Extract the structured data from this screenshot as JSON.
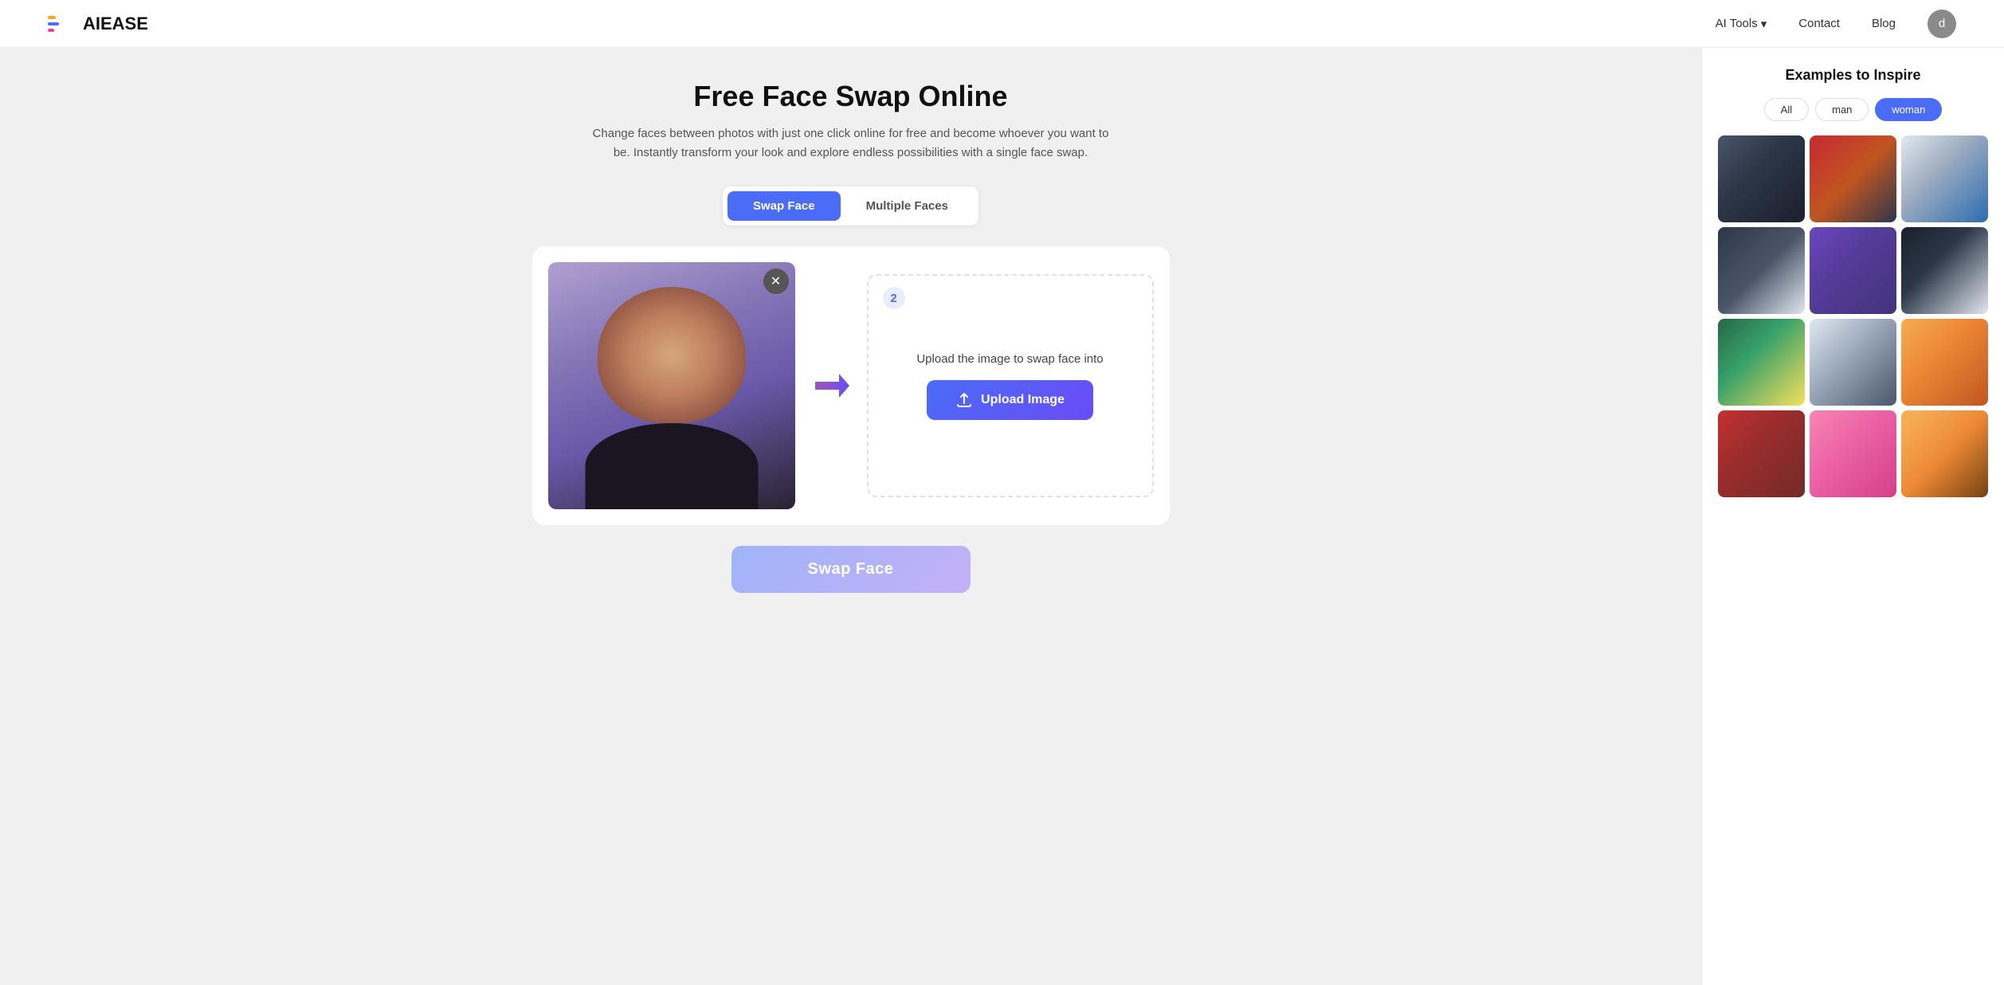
{
  "nav": {
    "logo_text": "AIEASE",
    "links": [
      {
        "label": "AI Tools",
        "has_dropdown": true
      },
      {
        "label": "Contact",
        "has_dropdown": false
      },
      {
        "label": "Blog",
        "has_dropdown": false
      }
    ],
    "avatar_letter": "d"
  },
  "main": {
    "page_title": "Free Face Swap Online",
    "page_description": "Change faces between photos with just one click online for free and become whoever you want to be. Instantly transform your look and explore endless possibilities with a single face swap.",
    "tabs": [
      {
        "label": "Swap Face",
        "active": true
      },
      {
        "label": "Multiple Faces",
        "active": false
      }
    ],
    "step2_badge": "2",
    "target_instruction": "Upload the image to swap face into",
    "upload_btn_label": "Upload Image",
    "swap_btn_label": "Swap Face",
    "arrow": "→"
  },
  "sidebar": {
    "title": "Examples to Inspire",
    "filters": [
      {
        "label": "All",
        "active": false
      },
      {
        "label": "man",
        "active": false
      },
      {
        "label": "woman",
        "active": true
      }
    ],
    "gallery_items": [
      {
        "id": 1,
        "class": "gal-1"
      },
      {
        "id": 2,
        "class": "gal-2"
      },
      {
        "id": 3,
        "class": "gal-3"
      },
      {
        "id": 4,
        "class": "gal-4"
      },
      {
        "id": 5,
        "class": "gal-5"
      },
      {
        "id": 6,
        "class": "gal-6"
      },
      {
        "id": 7,
        "class": "gal-7"
      },
      {
        "id": 8,
        "class": "gal-8"
      },
      {
        "id": 9,
        "class": "gal-9"
      },
      {
        "id": 10,
        "class": "gal-10"
      },
      {
        "id": 11,
        "class": "gal-11"
      },
      {
        "id": 12,
        "class": "gal-12"
      }
    ]
  }
}
